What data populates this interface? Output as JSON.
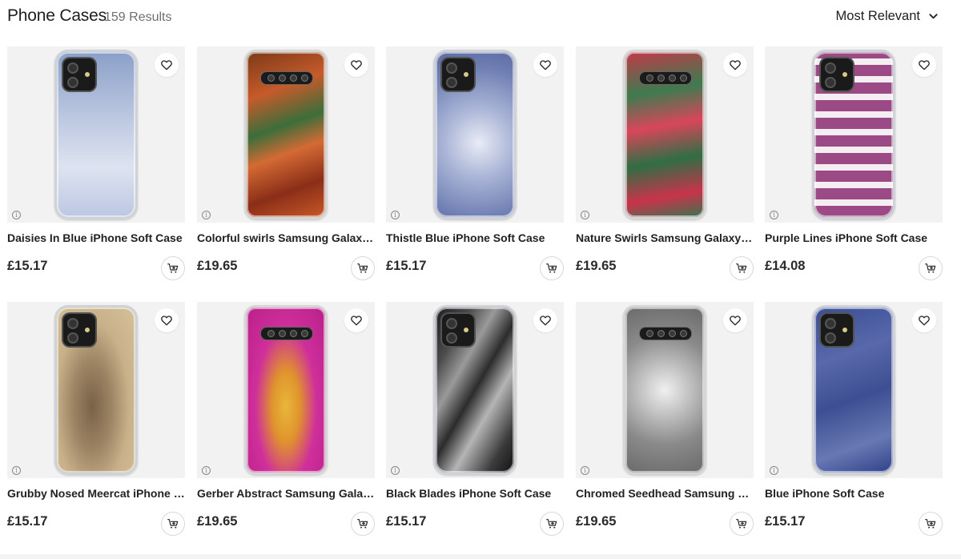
{
  "header": {
    "title": "Phone Cases",
    "results": "159 Results",
    "sort_label": "Most Relevant"
  },
  "products": [
    {
      "name": "Daisies In Blue iPhone Soft Case",
      "price": "£15.17",
      "kind": "iphone",
      "art": "linear-gradient(180deg,#8aa0c8 0%,#b7c3de 35%,#dde3f0 70%,#bcc7e2 100%)"
    },
    {
      "name": "Colorful swirls Samsung Galaxy Snap Case",
      "price": "£19.65",
      "kind": "galaxy",
      "art": "linear-gradient(160deg,#7a3a18 0%,#c75a2a 25%,#3c6e3a 45%,#d46a34 60%,#8a2e18 80%,#c95828 100%)"
    },
    {
      "name": "Thistle Blue iPhone Soft Case",
      "price": "£15.17",
      "kind": "iphone",
      "art": "radial-gradient(circle at 55% 55%,#e9ecf6 0%,#a9b4d6 35%,#6f7fb3 75%,#5a6aa2 100%)"
    },
    {
      "name": "Nature Swirls Samsung Galaxy Snap Case",
      "price": "£19.65",
      "kind": "galaxy",
      "art": "linear-gradient(170deg,#c23a4a 0%,#3e7b4f 25%,#d8465a 45%,#2f6e44 65%,#c8344a 85%,#3b7350 100%)"
    },
    {
      "name": "Purple Lines iPhone Soft Case",
      "price": "£14.08",
      "kind": "iphone",
      "art": "repeating-linear-gradient(0deg,#9b4a86 0px,#9b4a86 14px,#f4eef3 14px,#f4eef3 22px), repeating-linear-gradient(90deg,#9b4a86 0px,#9b4a86 12px,#f4eef3 12px,#f4eef3 20px)"
    },
    {
      "name": "Grubby Nosed Meercat iPhone Soft Case",
      "price": "£15.17",
      "kind": "iphone",
      "art": "radial-gradient(ellipse at 45% 60%,#7a6248 0%,#9a8262 30%,#c8b08a 60%,#d6c29c 100%)"
    },
    {
      "name": "Gerber Abstract Samsung Galaxy Snap Case",
      "price": "£19.65",
      "kind": "galaxy",
      "art": "radial-gradient(ellipse at 50% 60%,#e7b73a 0%,#e0942c 25%,#cf2f9a 55%,#b81f8a 100%)"
    },
    {
      "name": "Black Blades iPhone Soft Case",
      "price": "£15.17",
      "kind": "iphone",
      "art": "linear-gradient(120deg,#1c1c1c 0%,#4a4a4a 20%,#9a9a9a 35%,#2c2c2c 50%,#b5b5b5 65%,#3a3a3a 85%,#111 100%)"
    },
    {
      "name": "Chromed Seedhead Samsung Galaxy Snap Case",
      "price": "£19.65",
      "kind": "galaxy",
      "art": "radial-gradient(circle at 50% 50%,#f0f0f0 0%,#bdbdbd 30%,#8a8a8a 60%,#6a6a6a 100%)"
    },
    {
      "name": "Blue iPhone Soft Case",
      "price": "£15.17",
      "kind": "iphone",
      "art": "linear-gradient(160deg,#3a4e96 0%,#5868aa 30%,#3d4f92 55%,#6878b4 80%,#2f4088 100%)"
    }
  ]
}
